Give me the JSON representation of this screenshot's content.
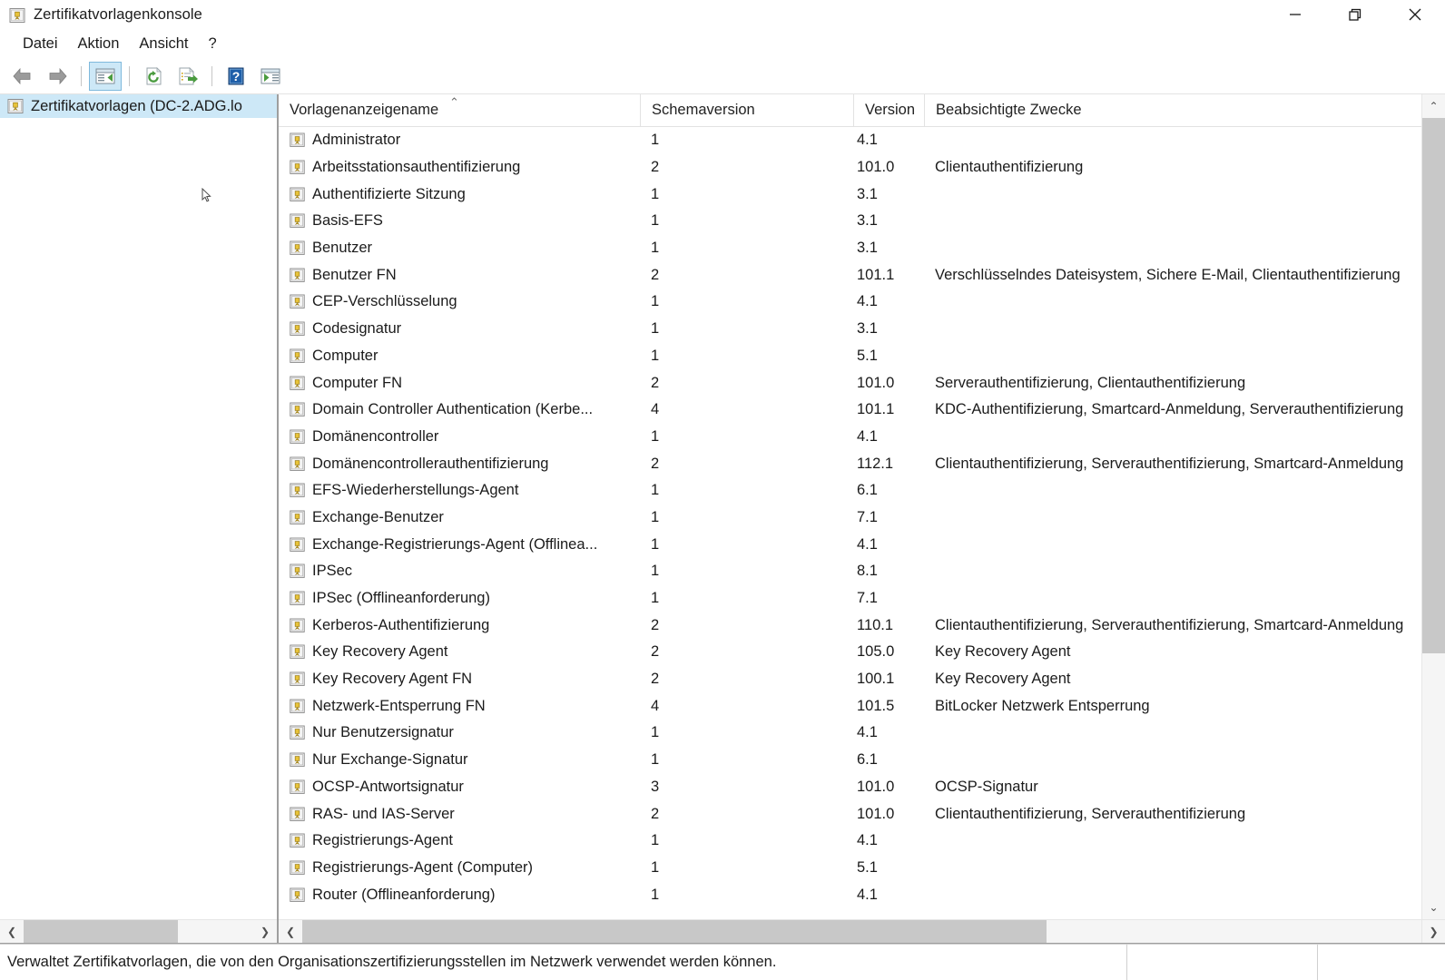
{
  "window": {
    "title": "Zertifikatvorlagenkonsole",
    "icon": "certificate-template-icon",
    "controls": {
      "minimize": "minimize-icon",
      "restore": "restore-icon",
      "close": "close-icon"
    }
  },
  "menubar": {
    "items": [
      {
        "label": "Datei"
      },
      {
        "label": "Aktion"
      },
      {
        "label": "Ansicht"
      },
      {
        "label": "?"
      }
    ]
  },
  "toolbar": {
    "buttons": [
      {
        "name": "back-arrow-icon",
        "label": "Zurück"
      },
      {
        "name": "forward-arrow-icon",
        "label": "Vorwärts"
      },
      {
        "name": "show-hide-console-tree-icon",
        "label": "Konsolenstruktur ein-/ausblenden",
        "active": true
      },
      {
        "name": "refresh-icon",
        "label": "Aktualisieren"
      },
      {
        "name": "export-list-icon",
        "label": "Liste exportieren"
      },
      {
        "name": "help-icon",
        "label": "Hilfe"
      },
      {
        "name": "show-action-pane-icon",
        "label": "Aktionsbereich anzeigen/ausblenden"
      }
    ]
  },
  "tree": {
    "root": {
      "label": "Zertifikatvorlagen (DC-2.ADG.lo",
      "icon": "certificate-template-icon",
      "selected": true
    }
  },
  "list": {
    "columns": [
      {
        "key": "name",
        "label": "Vorlagenanzeigename",
        "sorted": "asc",
        "sort_glyph": "⌃"
      },
      {
        "key": "schema",
        "label": "Schemaversion"
      },
      {
        "key": "version",
        "label": "Version"
      },
      {
        "key": "purposes",
        "label": "Beabsichtigte Zwecke"
      }
    ],
    "rows": [
      {
        "name": "Administrator",
        "schema": "1",
        "version": "4.1",
        "purposes": ""
      },
      {
        "name": "Arbeitsstationsauthentifizierung",
        "schema": "2",
        "version": "101.0",
        "purposes": "Clientauthentifizierung"
      },
      {
        "name": "Authentifizierte Sitzung",
        "schema": "1",
        "version": "3.1",
        "purposes": ""
      },
      {
        "name": "Basis-EFS",
        "schema": "1",
        "version": "3.1",
        "purposes": ""
      },
      {
        "name": "Benutzer",
        "schema": "1",
        "version": "3.1",
        "purposes": ""
      },
      {
        "name": "Benutzer FN",
        "schema": "2",
        "version": "101.1",
        "purposes": "Verschlüsselndes Dateisystem, Sichere E-Mail, Clientauthentifizierung"
      },
      {
        "name": "CEP-Verschlüsselung",
        "schema": "1",
        "version": "4.1",
        "purposes": ""
      },
      {
        "name": "Codesignatur",
        "schema": "1",
        "version": "3.1",
        "purposes": ""
      },
      {
        "name": "Computer",
        "schema": "1",
        "version": "5.1",
        "purposes": ""
      },
      {
        "name": "Computer FN",
        "schema": "2",
        "version": "101.0",
        "purposes": "Serverauthentifizierung, Clientauthentifizierung"
      },
      {
        "name": "Domain Controller Authentication (Kerbe...",
        "schema": "4",
        "version": "101.1",
        "purposes": "KDC-Authentifizierung, Smartcard-Anmeldung, Serverauthentifizierung"
      },
      {
        "name": "Domänencontroller",
        "schema": "1",
        "version": "4.1",
        "purposes": ""
      },
      {
        "name": "Domänencontrollerauthentifizierung",
        "schema": "2",
        "version": "112.1",
        "purposes": "Clientauthentifizierung, Serverauthentifizierung, Smartcard-Anmeldung"
      },
      {
        "name": "EFS-Wiederherstellungs-Agent",
        "schema": "1",
        "version": "6.1",
        "purposes": ""
      },
      {
        "name": "Exchange-Benutzer",
        "schema": "1",
        "version": "7.1",
        "purposes": ""
      },
      {
        "name": "Exchange-Registrierungs-Agent (Offlinea...",
        "schema": "1",
        "version": "4.1",
        "purposes": ""
      },
      {
        "name": "IPSec",
        "schema": "1",
        "version": "8.1",
        "purposes": ""
      },
      {
        "name": "IPSec (Offlineanforderung)",
        "schema": "1",
        "version": "7.1",
        "purposes": ""
      },
      {
        "name": "Kerberos-Authentifizierung",
        "schema": "2",
        "version": "110.1",
        "purposes": "Clientauthentifizierung, Serverauthentifizierung, Smartcard-Anmeldung"
      },
      {
        "name": "Key Recovery Agent",
        "schema": "2",
        "version": "105.0",
        "purposes": "Key Recovery Agent"
      },
      {
        "name": "Key Recovery Agent FN",
        "schema": "2",
        "version": "100.1",
        "purposes": "Key Recovery Agent"
      },
      {
        "name": "Netzwerk-Entsperrung FN",
        "schema": "4",
        "version": "101.5",
        "purposes": "BitLocker Netzwerk Entsperrung"
      },
      {
        "name": "Nur Benutzersignatur",
        "schema": "1",
        "version": "4.1",
        "purposes": ""
      },
      {
        "name": "Nur Exchange-Signatur",
        "schema": "1",
        "version": "6.1",
        "purposes": ""
      },
      {
        "name": "OCSP-Antwortsignatur",
        "schema": "3",
        "version": "101.0",
        "purposes": "OCSP-Signatur"
      },
      {
        "name": "RAS- und IAS-Server",
        "schema": "2",
        "version": "101.0",
        "purposes": "Clientauthentifizierung, Serverauthentifizierung"
      },
      {
        "name": "Registrierungs-Agent",
        "schema": "1",
        "version": "4.1",
        "purposes": ""
      },
      {
        "name": "Registrierungs-Agent (Computer)",
        "schema": "1",
        "version": "5.1",
        "purposes": ""
      },
      {
        "name": "Router (Offlineanforderung)",
        "schema": "1",
        "version": "4.1",
        "purposes": ""
      }
    ]
  },
  "scrollbars": {
    "up_glyph": "⌃",
    "down_glyph": "⌄",
    "left_glyph": "❮",
    "right_glyph": "❯"
  },
  "statusbar": {
    "message": "Verwaltet Zertifikatvorlagen, die von den Organisationszertifizierungsstellen im Netzwerk verwendet werden können.",
    "panel2": "",
    "panel3": ""
  },
  "colors": {
    "selection": "#cde8f7",
    "toolbar_active_border": "#7fb9dc",
    "scroll_thumb": "#c8c8c8",
    "pane_border": "#9e9e9e",
    "text": "#1b1b1b"
  }
}
